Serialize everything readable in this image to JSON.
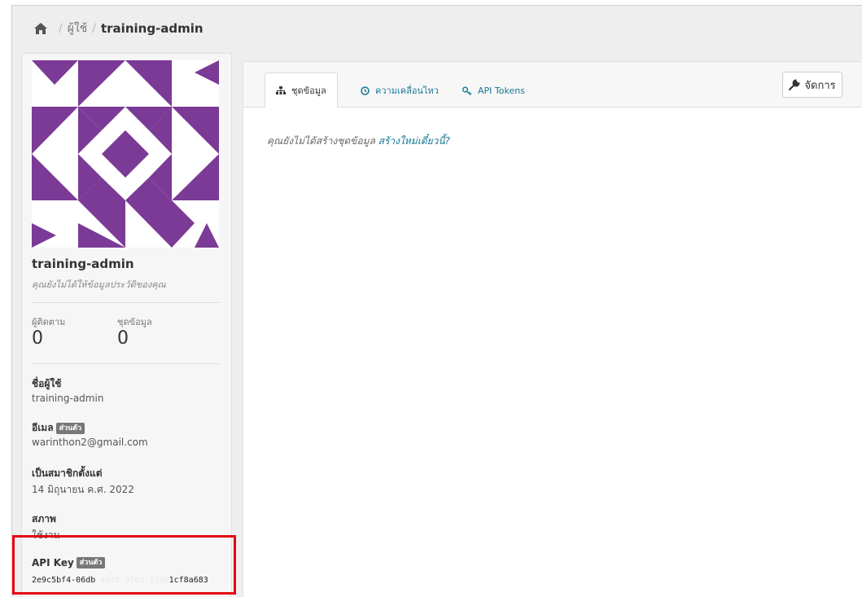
{
  "breadcrumb": {
    "home_icon": "home-icon",
    "separator": "/",
    "users_label": "ผู้ใช้",
    "current_label": "training-admin"
  },
  "profile": {
    "avatar_icon": "identicon",
    "avatar_color": "#7b3a96",
    "name": "training-admin",
    "about": "คุณยังไม่ได้ให้ข้อมูลประวัติของคุณ",
    "followers_label": "ผู้ติดตาม",
    "followers_count": "0",
    "datasets_label": "ชุดข้อมูล",
    "datasets_count": "0",
    "username_label": "ชื่อผู้ใช้",
    "username_value": "training-admin",
    "email_label": "อีเมล",
    "private_badge": "ส่วนตัว",
    "email_value": "warinthon2@gmail.com",
    "member_since_label": "เป็นสมาชิกตั้งแต่",
    "member_since_value": "14 มิถุนายน ค.ศ. 2022",
    "state_label": "สภาพ",
    "state_value": "ใช้งาน",
    "api_key_label": "API Key",
    "api_key_visible_start": "2e9c5bf4-06db",
    "api_key_blurred": "-4b35-97e2-118e",
    "api_key_visible_end": "1cf8a683"
  },
  "tabs": [
    {
      "label": "ชุดข้อมูล",
      "icon": "sitemap-icon",
      "active": true
    },
    {
      "label": "ความเคลื่อนไหว",
      "icon": "clock-icon",
      "active": false
    },
    {
      "label": "API Tokens",
      "icon": "key-icon",
      "active": false
    }
  ],
  "manage_button": {
    "label": "จัดการ",
    "icon": "wrench-icon"
  },
  "main": {
    "empty_message": "คุณยังไม่ได้สร้างชุดข้อมูล",
    "create_link": "สร้างใหม่เดี๋ยวนี้?"
  },
  "colors": {
    "accent_link": "#187794",
    "highlight_box": "#e30613",
    "badge_bg": "#777777"
  }
}
